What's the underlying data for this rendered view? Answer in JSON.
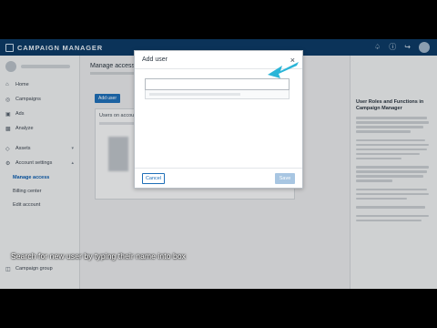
{
  "app": {
    "title": "CAMPAIGN MANAGER"
  },
  "topbar": {
    "icons": [
      "bell-icon",
      "help-icon",
      "logout-icon",
      "avatar"
    ]
  },
  "sidebar": {
    "items": [
      {
        "label": "Home",
        "icon": "home-icon"
      },
      {
        "label": "Campaigns",
        "icon": "campaign-icon"
      },
      {
        "label": "Ads",
        "icon": "ads-icon"
      },
      {
        "label": "Analyze",
        "icon": "chart-icon"
      }
    ],
    "items2": [
      {
        "label": "Assets",
        "icon": "asset-icon"
      },
      {
        "label": "Account settings",
        "icon": "gear-icon"
      }
    ],
    "subitems": [
      {
        "label": "Manage access"
      },
      {
        "label": "Billing center"
      },
      {
        "label": "Edit account"
      }
    ],
    "footer": {
      "label": "Campaign group"
    }
  },
  "main": {
    "title": "Manage access",
    "add_user_label": "Add user",
    "card_title": "Users on account"
  },
  "right_panel": {
    "title": "User Roles and Functions in Campaign Manager",
    "sections": [
      {
        "label": ""
      },
      {
        "label": ""
      },
      {
        "label": ""
      },
      {
        "label": ""
      },
      {
        "label": ""
      }
    ]
  },
  "modal": {
    "title": "Add user",
    "close_label": "×",
    "search": {
      "value": "",
      "placeholder": ""
    },
    "cancel_label": "Cancel",
    "save_label": "Save"
  },
  "caption": "Search for new user by typing their name into box",
  "colors": {
    "brand": "#0d3b66",
    "accent": "#1f6fb8",
    "arrow": "#2bb5d8"
  }
}
